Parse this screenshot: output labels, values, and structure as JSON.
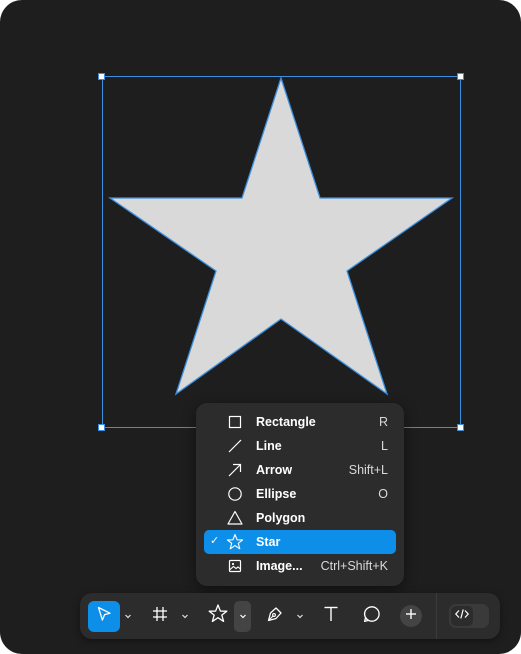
{
  "canvas": {
    "background": "#1e1e1e",
    "shape": {
      "type": "star",
      "fill": "#d9d9d9",
      "stroke": "#3b8fe0"
    },
    "selection_color": "#3b8fe0"
  },
  "shape_menu": {
    "items": [
      {
        "label": "Rectangle",
        "shortcut": "R",
        "icon": "rectangle-icon",
        "selected": false
      },
      {
        "label": "Line",
        "shortcut": "L",
        "icon": "line-icon",
        "selected": false
      },
      {
        "label": "Arrow",
        "shortcut": "Shift+L",
        "icon": "arrow-icon",
        "selected": false
      },
      {
        "label": "Ellipse",
        "shortcut": "O",
        "icon": "ellipse-icon",
        "selected": false
      },
      {
        "label": "Polygon",
        "shortcut": "",
        "icon": "polygon-icon",
        "selected": false
      },
      {
        "label": "Star",
        "shortcut": "",
        "icon": "star-icon",
        "selected": true
      },
      {
        "label": "Image...",
        "shortcut": "Ctrl+Shift+K",
        "icon": "image-icon",
        "selected": false
      }
    ],
    "check_mark": "✓",
    "accent": "#0d8ee9"
  },
  "toolbar": {
    "tools": [
      "move-tool",
      "frame-tool",
      "shape-tool",
      "pen-tool",
      "text-tool",
      "comment-tool",
      "actions-tool"
    ],
    "active_tool": "move-tool",
    "dev_mode_icon": "code-icon"
  }
}
